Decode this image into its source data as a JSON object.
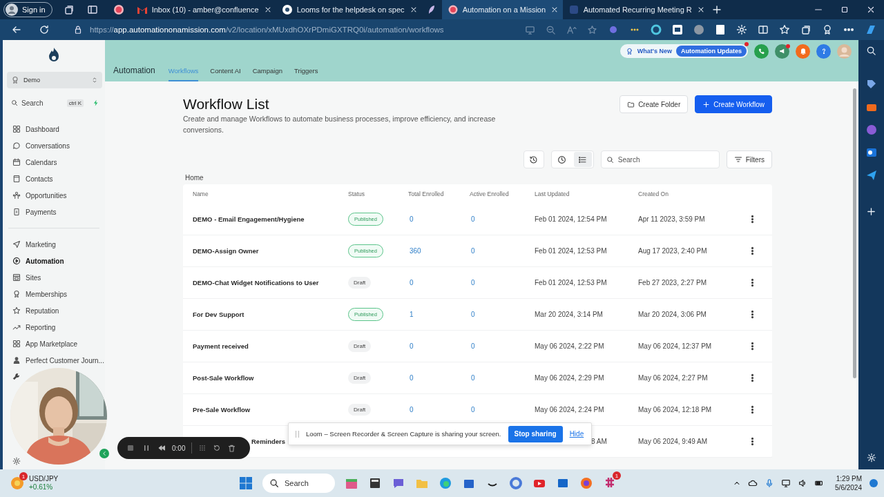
{
  "browser": {
    "profile": "Sign in",
    "tabs": [
      {
        "title": "Inbox (10) - amber@confluence",
        "kind": "mail",
        "selected": false
      },
      {
        "title": "Looms for the helpdesk on spec",
        "kind": "letter",
        "selected": false
      },
      {
        "kind": "pinned",
        "selected": false
      },
      {
        "title": "Automation on a Mission",
        "kind": "record",
        "selected": true
      },
      {
        "title": "Automated Recurring Meeting R",
        "kind": "blank",
        "selected": false
      }
    ],
    "address": {
      "scheme": "https://",
      "domain": "app.automationonamission.com",
      "path": "/v2/location/xMUxdhOXrPDmiGXTRQ0i/automation/workflows"
    }
  },
  "sidebar": {
    "account": "Demo",
    "search": "Search",
    "shortcut": "ctrl K",
    "sections": [
      {
        "items": [
          {
            "label": "Dashboard",
            "selected": false
          },
          {
            "label": "Conversations",
            "selected": false
          },
          {
            "label": "Calendars",
            "selected": false
          },
          {
            "label": "Contacts",
            "selected": false
          },
          {
            "label": "Opportunities",
            "selected": false
          },
          {
            "label": "Payments",
            "selected": false
          }
        ]
      },
      {
        "items": [
          {
            "label": "Marketing",
            "selected": false
          },
          {
            "label": "Automation",
            "selected": true
          },
          {
            "label": "Sites",
            "selected": false
          },
          {
            "label": "Memberships",
            "selected": false
          },
          {
            "label": "Reputation",
            "selected": false
          },
          {
            "label": "Reporting",
            "selected": false
          },
          {
            "label": "App Marketplace",
            "selected": false
          },
          {
            "label": "Perfect Customer Journ...",
            "selected": false
          }
        ]
      }
    ]
  },
  "header": {
    "title": "Automation",
    "tabs": [
      {
        "label": "Workflows",
        "selected": true
      },
      {
        "label": "Content AI",
        "selected": false
      },
      {
        "label": "Campaign",
        "selected": false
      },
      {
        "label": "Triggers",
        "selected": false
      }
    ],
    "whats_new": "What's New",
    "updates": "Automation Updates"
  },
  "page": {
    "title": "Workflow List",
    "description": "Create and manage Workflows to automate business processes, improve efficiency, and increase conversions.",
    "buttons": [
      {
        "label": "Create Folder",
        "kind": "secondary"
      },
      {
        "label": "Create Workflow",
        "kind": "primary"
      }
    ],
    "view_modes": [
      {
        "kind": "clock",
        "selected": false
      },
      {
        "kind": "list",
        "selected": true
      }
    ],
    "search": {
      "placeholder": "Search"
    },
    "filters": "Filters",
    "breadcrumb": "Home",
    "columns": [
      "Name",
      "Status",
      "Total Enrolled",
      "Active Enrolled",
      "Last Updated",
      "Created On"
    ],
    "rows": [
      {
        "kind": "full",
        "name": "DEMO - Email Engagement/Hygiene",
        "status": {
          "label": "Published",
          "kind": "published"
        },
        "total": "0",
        "active": "0",
        "last_updated": "Feb 01 2024, 12:54 PM",
        "created_on": "Apr 11 2023, 3:59 PM"
      },
      {
        "kind": "full",
        "name": "DEMO-Assign Owner",
        "status": {
          "label": "Published",
          "kind": "published"
        },
        "total": "360",
        "active": "0",
        "last_updated": "Feb 01 2024, 12:53 PM",
        "created_on": "Aug 17 2023, 2:40 PM"
      },
      {
        "kind": "full",
        "name": "DEMO-Chat Widget Notifications to User",
        "status": {
          "label": "Draft",
          "kind": "draft"
        },
        "total": "0",
        "active": "0",
        "last_updated": "Feb 01 2024, 12:53 PM",
        "created_on": "Feb 27 2023, 2:27 PM"
      },
      {
        "kind": "full",
        "name": "For Dev Support",
        "status": {
          "label": "Published",
          "kind": "published"
        },
        "total": "1",
        "active": "0",
        "last_updated": "Mar 20 2024, 3:14 PM",
        "created_on": "Mar 20 2024, 3:06 PM"
      },
      {
        "kind": "full",
        "name": "Payment received",
        "status": {
          "label": "Draft",
          "kind": "draft"
        },
        "total": "0",
        "active": "0",
        "last_updated": "May 06 2024, 2:22 PM",
        "created_on": "May 06 2024, 12:37 PM"
      },
      {
        "kind": "full",
        "name": "Post-Sale Workflow",
        "status": {
          "label": "Draft",
          "kind": "draft"
        },
        "total": "0",
        "active": "0",
        "last_updated": "May 06 2024, 2:29 PM",
        "created_on": "May 06 2024, 2:27 PM"
      },
      {
        "kind": "full",
        "name": "Pre-Sale Workflow",
        "status": {
          "label": "Draft",
          "kind": "draft"
        },
        "total": "0",
        "active": "0",
        "last_updated": "May 06 2024, 2:24 PM",
        "created_on": "May 06 2024, 12:18 PM"
      },
      {
        "kind": "partial",
        "name": "Reminders",
        "last_updated": "8 AM",
        "created_on": "May 06 2024, 9:49 AM"
      }
    ]
  },
  "overlays": {
    "recorder": {
      "time": "0:00"
    },
    "loom": {
      "message": "Loom – Screen Recorder & Screen Capture is sharing your screen.",
      "stop": "Stop sharing",
      "hide": "Hide"
    }
  },
  "taskbar": {
    "ticker": {
      "symbol": "USD/JPY",
      "change": "+0.61%",
      "badge": "1"
    },
    "search": {
      "placeholder": "Search"
    },
    "app_badge": "1",
    "time": "1:29 PM",
    "date": "5/6/2024"
  }
}
